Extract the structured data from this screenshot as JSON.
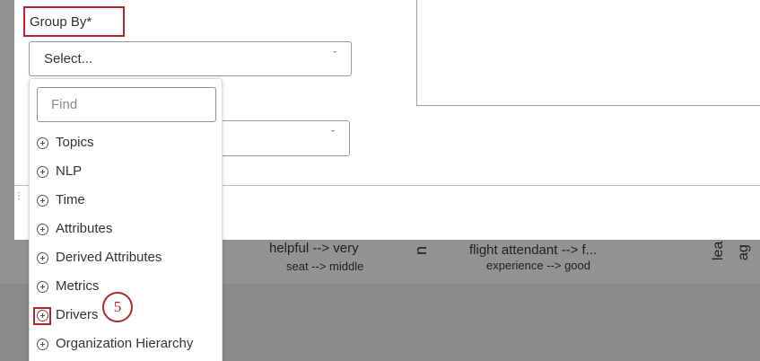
{
  "background": {
    "words": [
      "helpful --> very",
      "seat --> middle",
      "flight attendant --> f...",
      "experience --> good"
    ],
    "rotated": [
      "n",
      "lea",
      "ag"
    ]
  },
  "form": {
    "group_by_label": "Group By*",
    "select_placeholder": "Select...",
    "chevron": "ˇ"
  },
  "dropdown": {
    "search_placeholder": "Find",
    "options": [
      {
        "label": "Topics",
        "icon": "plus-circle-icon"
      },
      {
        "label": "NLP",
        "icon": "plus-circle-icon"
      },
      {
        "label": "Time",
        "icon": "plus-circle-icon"
      },
      {
        "label": "Attributes",
        "icon": "plus-circle-icon"
      },
      {
        "label": "Derived Attributes",
        "icon": "plus-circle-icon"
      },
      {
        "label": "Metrics",
        "icon": "plus-circle-icon"
      },
      {
        "label": "Drivers",
        "icon": "plus-circle-icon"
      },
      {
        "label": "Organization Hierarchy",
        "icon": "plus-circle-icon"
      }
    ]
  },
  "annotation": {
    "step_number": "5",
    "color": "#b3262d"
  }
}
